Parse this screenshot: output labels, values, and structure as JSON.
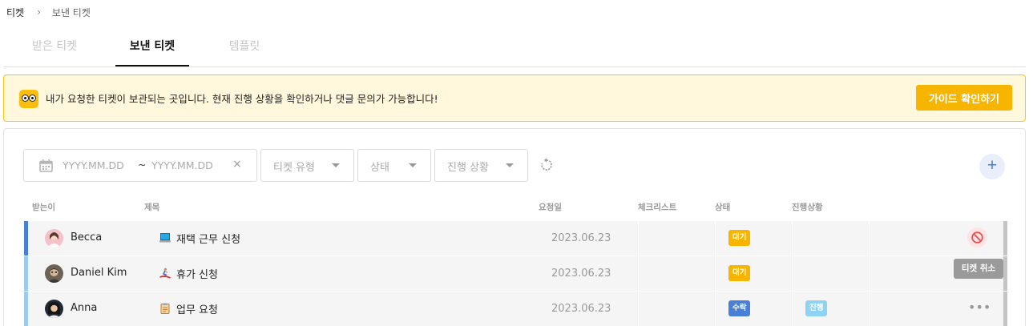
{
  "breadcrumb": {
    "root": "티켓",
    "separator": "›",
    "current": "보낸 티켓"
  },
  "tabs": [
    {
      "label": "받은 티켓",
      "active": false
    },
    {
      "label": "보낸 티켓",
      "active": true
    },
    {
      "label": "템플릿",
      "active": false
    }
  ],
  "notice": {
    "icon": "mascot-icon",
    "text": "내가 요청한 티켓이 보관되는 곳입니다. 현재 진행 상황을 확인하거나 댓글 문의가 가능합니다!",
    "button_label": "가이드 확인하기"
  },
  "filters": {
    "date_from_placeholder": "YYYY.MM.DD",
    "date_separator": "~",
    "date_to_placeholder": "YYYY.MM.DD",
    "clear_symbol": "×",
    "ticket_type": "티켓 유형",
    "status": "상태",
    "progress": "진행 상황",
    "add_symbol": "+"
  },
  "table": {
    "headers": {
      "recipient": "받는이",
      "title": "제목",
      "request_date": "요청일",
      "checklist": "체크리스트",
      "status": "상태",
      "progress": "진행상황"
    },
    "rows": [
      {
        "recipient": "Becca",
        "title": "재택 근무 신청",
        "title_icon": "laptop-icon",
        "date": "2023.06.23",
        "status": "대기",
        "progress": "",
        "accent": "#4a7fd8",
        "action": "cancel"
      },
      {
        "recipient": "Daniel Kim",
        "title": "휴가 신청",
        "title_icon": "surfer-icon",
        "date": "2023.06.23",
        "status": "대기",
        "progress": "",
        "accent": "#9ccbee",
        "action": "none"
      },
      {
        "recipient": "Anna",
        "title": "업무 요청",
        "title_icon": "clipboard-icon",
        "date": "2023.06.23",
        "status": "수락",
        "progress": "진행",
        "accent": "#9ccbee",
        "action": "more"
      }
    ]
  },
  "tooltip": "티켓 취소",
  "colors": {
    "accent_yellow": "#f7b500",
    "accent_blue": "#4a7fd8",
    "progress_blue": "#8fd3f4",
    "cancel_red": "#e05252"
  }
}
